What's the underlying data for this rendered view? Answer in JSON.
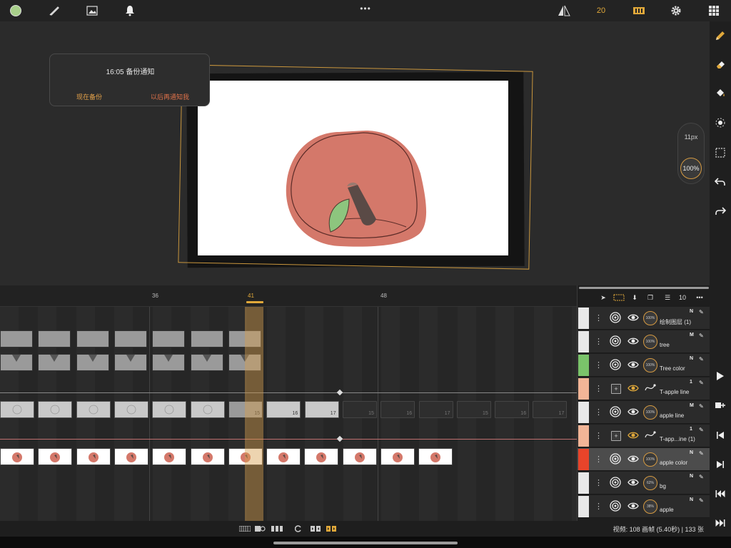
{
  "colors": {
    "accent": "#e0a83a",
    "current_color": "#a8cf8a",
    "apple": "#d4786a",
    "leaf": "#8dc57e",
    "stem": "#5a4a46"
  },
  "toolbar": {
    "fps": "20",
    "icons": [
      "color-swatch",
      "brush-icon",
      "image-icon",
      "bell-icon",
      "more-icon",
      "flip-icon",
      "filmstrip-icon",
      "gear-icon",
      "grid-icon"
    ]
  },
  "notification": {
    "title": "16:05 备份通知",
    "backup_now": "现在备份",
    "remind_later": "以后再通知我"
  },
  "brush": {
    "size": "11px",
    "opacity": "100%"
  },
  "timeline": {
    "ruler_labels": [
      {
        "text": "36"
      },
      {
        "text": "41",
        "current": true
      },
      {
        "text": "48"
      }
    ],
    "track_b_numbers": [
      "15",
      "16",
      "17",
      "15",
      "16",
      "17",
      "15",
      "16",
      "17"
    ]
  },
  "layers_toolbar": {
    "count": "10"
  },
  "layers": [
    {
      "name": "绘制图层 (1)",
      "flag": "N",
      "opacity": "100%",
      "swatch": "#e8e8e8",
      "type": "draw"
    },
    {
      "name": "tree",
      "flag": "M",
      "opacity": "100%",
      "swatch": "#e8e8e8",
      "type": "draw"
    },
    {
      "name": "Tree color",
      "flag": "N",
      "opacity": "100%",
      "swatch": "#7ac36a",
      "type": "draw"
    },
    {
      "name": "T-apple line",
      "flag": "1",
      "opacity": "",
      "swatch": "#f2b597",
      "type": "transform"
    },
    {
      "name": "apple line",
      "flag": "M",
      "opacity": "100%",
      "swatch": "#e8e8e8",
      "type": "draw"
    },
    {
      "name": "T-app...ine (1)",
      "flag": "1",
      "opacity": "",
      "swatch": "#f2b597",
      "type": "transform"
    },
    {
      "name": "apple color",
      "flag": "N",
      "opacity": "100%",
      "swatch": "#e8442a",
      "type": "draw",
      "selected": true
    },
    {
      "name": "bg",
      "flag": "N",
      "opacity": "62%",
      "swatch": "#e8e8e8",
      "type": "draw"
    },
    {
      "name": "apple",
      "flag": "N",
      "opacity": "38%",
      "swatch": "#e8e8e8",
      "type": "draw"
    }
  ],
  "status": {
    "video_info": "视频: 108 画帧 (5.40秒) | 133 张"
  }
}
